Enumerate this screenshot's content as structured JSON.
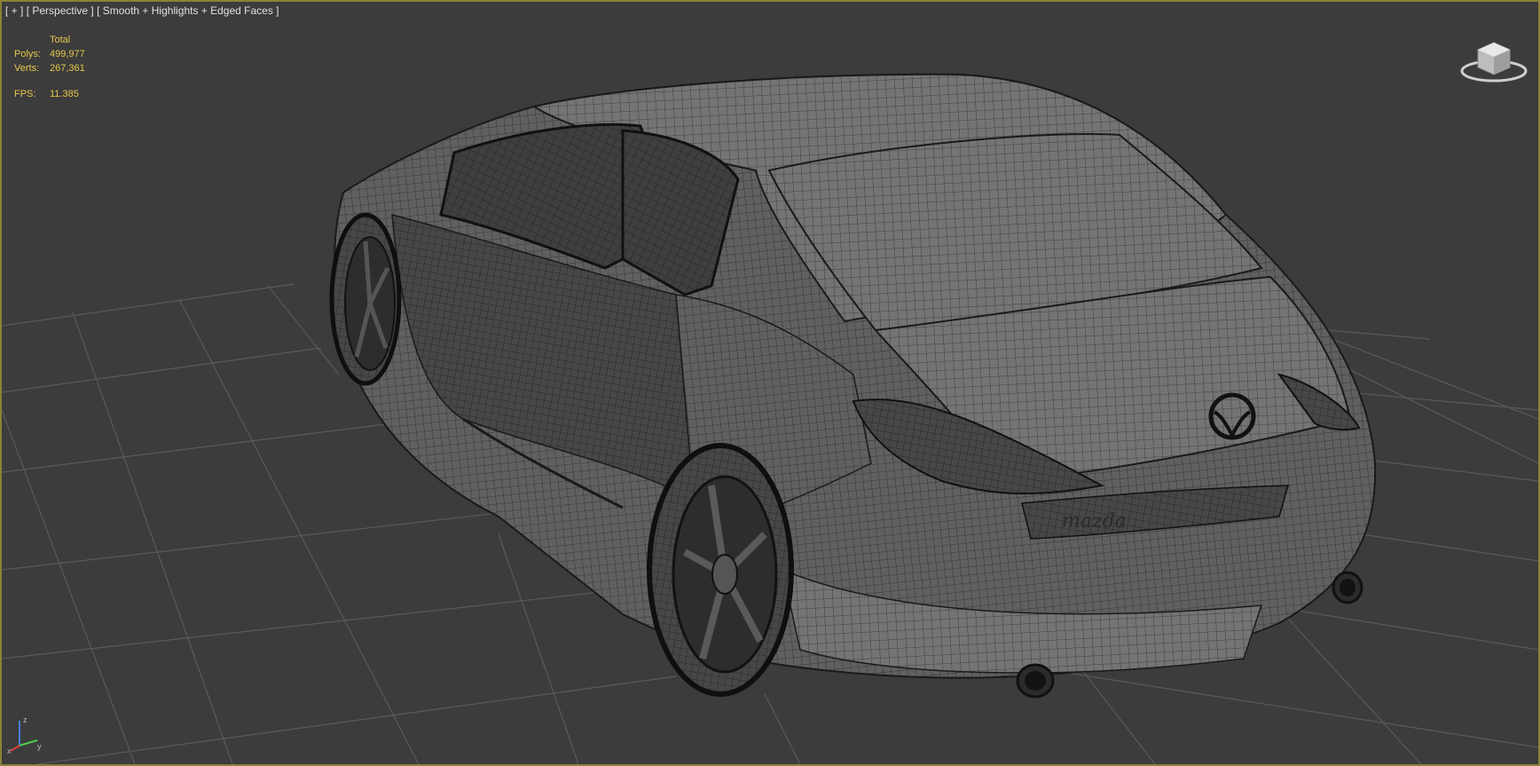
{
  "viewport": {
    "menu": {
      "plus": "[ + ]",
      "view": "[ Perspective ]",
      "shading": "[ Smooth + Highlights + Edged Faces ]"
    },
    "stats": {
      "header": "Total",
      "polys_label": "Polys:",
      "polys_value": "499,977",
      "verts_label": "Verts:",
      "verts_value": "267,361",
      "fps_label": "FPS:",
      "fps_value": "11.385"
    },
    "axes": {
      "z": "z",
      "y": "y",
      "x": "x"
    },
    "car": {
      "badge_text": "mazda"
    }
  },
  "colors": {
    "border": "#8b8138",
    "background": "#3c3c3c",
    "grid": "#5a5a5a",
    "stats_text": "#e6c84a",
    "menu_text": "#e0e0e0"
  },
  "icons": [
    "viewcube-icon",
    "axis-tripod-icon"
  ]
}
